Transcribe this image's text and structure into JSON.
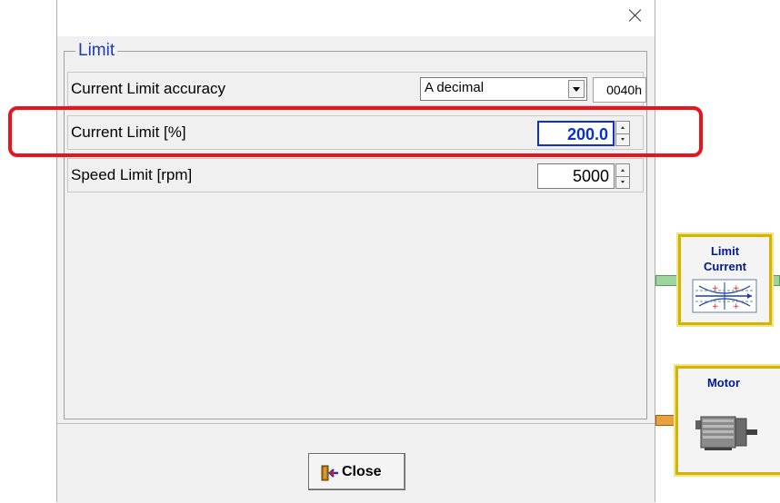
{
  "group": {
    "title": "Limit"
  },
  "rows": {
    "accuracy": {
      "label": "Current Limit accuracy",
      "selected": "A decimal",
      "code": "0040h"
    },
    "current_limit": {
      "label": "Current Limit [%]",
      "value": "200.0"
    },
    "speed_limit": {
      "label": "Speed Limit [rpm]",
      "value": "5000"
    }
  },
  "footer": {
    "close_label": "Close"
  },
  "diagram": {
    "limit_block": {
      "line1": "Limit",
      "line2": "Current"
    },
    "motor_block": {
      "title": "Motor"
    }
  },
  "colors": {
    "accent_blue": "#1a3bb5",
    "highlight_red": "#e8141c",
    "block_border": "#d6b300",
    "connector_green": "#9ed49e",
    "connector_orange": "#e8a13c"
  },
  "icons": {
    "window_close": "close-icon",
    "close_button": "exit-door-icon"
  }
}
